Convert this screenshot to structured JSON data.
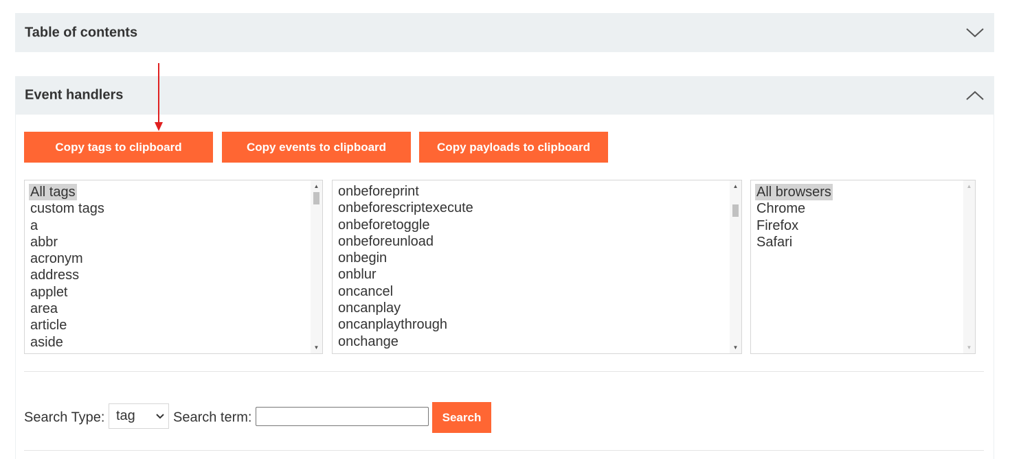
{
  "toc": {
    "title": "Table of contents",
    "icon": "chevron-down-icon"
  },
  "events_section": {
    "title": "Event handlers",
    "icon": "chevron-up-icon"
  },
  "buttons": {
    "copy_tags": "Copy tags to clipboard",
    "copy_events": "Copy events to clipboard",
    "copy_payloads": "Copy payloads to clipboard"
  },
  "tags_list": {
    "items": [
      "All tags",
      "custom tags",
      "a",
      "abbr",
      "acronym",
      "address",
      "applet",
      "area",
      "article",
      "aside"
    ],
    "selected": "All tags"
  },
  "events_list": {
    "items": [
      "onbeforeprint",
      "onbeforescriptexecute",
      "onbeforetoggle",
      "onbeforeunload",
      "onbegin",
      "onblur",
      "oncancel",
      "oncanplay",
      "oncanplaythrough",
      "onchange"
    ]
  },
  "browsers_list": {
    "items": [
      "All browsers",
      "Chrome",
      "Firefox",
      "Safari"
    ],
    "selected": "All browsers"
  },
  "search": {
    "type_label": "Search Type:",
    "type_value": "tag",
    "term_label": "Search term:",
    "term_value": "",
    "button_label": "Search"
  },
  "colors": {
    "accent": "#ff6633",
    "header_bg": "#ecf0f2",
    "selected_bg": "#d3d3d3",
    "annotation_arrow": "#e02020"
  }
}
